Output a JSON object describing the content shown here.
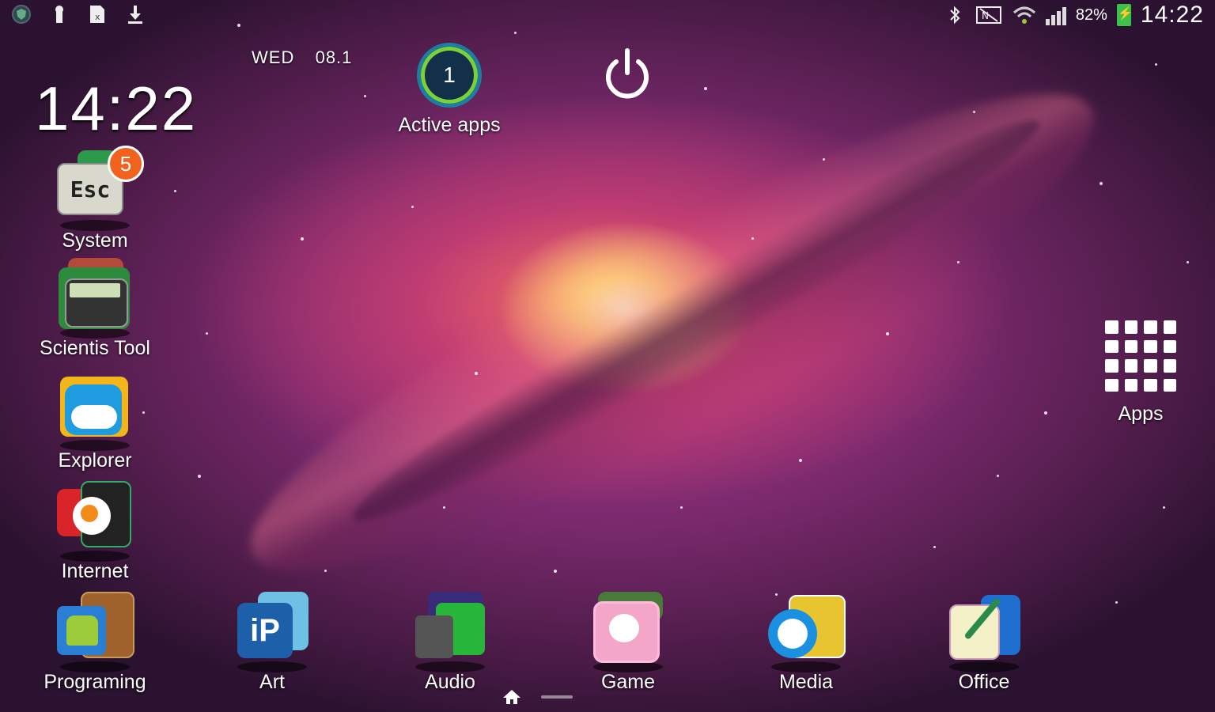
{
  "status_bar": {
    "left_icons": [
      "shield-icon",
      "keyhole-icon",
      "sim-card-icon",
      "download-icon"
    ],
    "right_icons": [
      "bluetooth-icon",
      "nfc-icon",
      "wifi-icon",
      "signal-icon"
    ],
    "battery_percent": "82%",
    "time": "14:22",
    "colors": {
      "battery_fill": "#3cc24a"
    }
  },
  "widget": {
    "day": "WED",
    "date": "08.1",
    "clock": "14:22"
  },
  "active_apps": {
    "count": "1",
    "label": "Active apps"
  },
  "power_button": {
    "icon": "power-icon"
  },
  "apps_button": {
    "label": "Apps",
    "icon": "grid-icon"
  },
  "folders_left": [
    {
      "label": "System",
      "badge": "5",
      "icon_text": "Esc"
    },
    {
      "label": "Scientis Tool"
    },
    {
      "label": "Explorer"
    },
    {
      "label": "Internet"
    }
  ],
  "dock": [
    {
      "label": "Programing"
    },
    {
      "label": "Art"
    },
    {
      "label": "Audio"
    },
    {
      "label": "Game"
    },
    {
      "label": "Media"
    },
    {
      "label": "Office"
    }
  ],
  "navigation": {
    "home_icon": "home-icon"
  }
}
